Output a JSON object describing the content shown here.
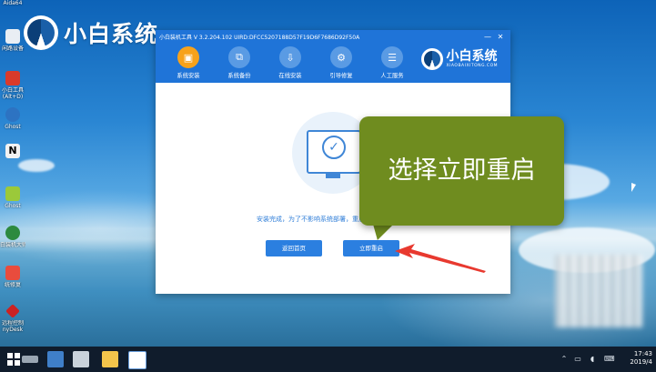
{
  "desktop": {
    "logo_name": "小白系统",
    "icons": [
      {
        "label": "Aida64",
        "color": "#d9d9d9"
      },
      {
        "label": "闲路设备",
        "color": "#e9eef4"
      },
      {
        "label": "小白工具",
        "color": "#d93a2b"
      },
      {
        "label": "(Alt+D)",
        "color": "#d93a2b"
      },
      {
        "label": "Ghost",
        "color": "#2d73c2"
      },
      {
        "label": "N",
        "color": "#f2f2f2"
      },
      {
        "label": "Ghost",
        "color": "#9bc93a"
      },
      {
        "label": "白装机大师",
        "color": "#2d8a3f"
      },
      {
        "label": "统修复",
        "color": "#e94c3d"
      },
      {
        "label": "远程控制",
        "color": "#cc2222"
      },
      {
        "label": "nyDesk",
        "color": "#cc2222"
      }
    ]
  },
  "app": {
    "title": "小白装机工具 V 3.2.204.102 UIRD:DFCC5207188D57F19D6F7686D92F50A",
    "window_controls": {
      "minimize": "—",
      "close": "✕"
    },
    "nav": [
      {
        "label": "系统安装",
        "icon": "install-icon",
        "glyph": "▣",
        "active": true
      },
      {
        "label": "系统备份",
        "icon": "backup-icon",
        "glyph": "⧉",
        "active": false
      },
      {
        "label": "在线安装",
        "icon": "online-install-icon",
        "glyph": "⇩",
        "active": false
      },
      {
        "label": "引导修复",
        "icon": "boot-repair-icon",
        "glyph": "⚙",
        "active": false
      },
      {
        "label": "人工服务",
        "icon": "service-icon",
        "glyph": "☰",
        "active": false
      }
    ],
    "brand": {
      "name": "小白系统",
      "sub": "XIAOBAIXITONG.COM"
    },
    "status_text": "安装完成，为了不影响系统部署，重启前请将外接设备",
    "buttons": {
      "back": "返回首页",
      "restart": "立即重启"
    }
  },
  "callout": {
    "text": "选择立即重启",
    "color": "#6f8c1f"
  },
  "taskbar": {
    "time": "17:43",
    "date": "2019/4"
  },
  "colors": {
    "app_header": "#1f74d8",
    "accent": "#2b7fe0",
    "active_nav": "#f7a21b",
    "arrow": "#e8392f"
  }
}
